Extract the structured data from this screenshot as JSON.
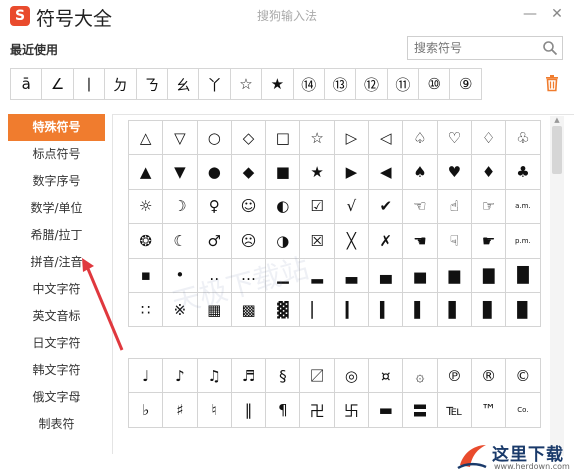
{
  "titlebar": {
    "logo_letter": "S",
    "app_title": "符号大全",
    "window_title": "搜狗输入法",
    "minimize": "—",
    "close": "✕"
  },
  "recent": {
    "label": "最近使用",
    "symbols": [
      "ā",
      "∠",
      "丨",
      "ㄉ",
      "ㄋ",
      "ㄠ",
      "丫",
      "☆",
      "★",
      "⑭",
      "⑬",
      "⑫",
      "⑪",
      "⑩",
      "⑨"
    ],
    "delete_icon": "trash-icon"
  },
  "search": {
    "placeholder": "搜索符号",
    "icon": "search-icon"
  },
  "sidebar": {
    "items": [
      {
        "label": "特殊符号",
        "active": true
      },
      {
        "label": "标点符号",
        "active": false
      },
      {
        "label": "数字序号",
        "active": false
      },
      {
        "label": "数学/单位",
        "active": false
      },
      {
        "label": "希腊/拉丁",
        "active": false
      },
      {
        "label": "拼音/注音",
        "active": false
      },
      {
        "label": "中文字符",
        "active": false
      },
      {
        "label": "英文音标",
        "active": false
      },
      {
        "label": "日文字符",
        "active": false
      },
      {
        "label": "韩文字符",
        "active": false
      },
      {
        "label": "俄文字母",
        "active": false
      },
      {
        "label": "制表符",
        "active": false
      }
    ]
  },
  "grid1": [
    [
      "△",
      "▽",
      "○",
      "◇",
      "□",
      "☆",
      "▷",
      "◁",
      "♤",
      "♡",
      "♢",
      "♧"
    ],
    [
      "▲",
      "▼",
      "●",
      "◆",
      "■",
      "★",
      "▶",
      "◀",
      "♠",
      "♥",
      "♦",
      "♣"
    ],
    [
      "☼",
      "☽",
      "♀",
      "☺",
      "◐",
      "☑",
      "√",
      "✔",
      "☜",
      "☝",
      "☞",
      "a.m."
    ],
    [
      "❂",
      "☾",
      "♂",
      "☹",
      "◑",
      "☒",
      "╳",
      "✗",
      "☚",
      "☟",
      "☛",
      "p.m."
    ],
    [
      "▪",
      "•",
      "‥",
      "…",
      "▁",
      "▂",
      "▃",
      "▄",
      "▅",
      "▆",
      "▇",
      "█"
    ],
    [
      "∷",
      "※",
      "▦",
      "▩",
      "▓",
      "▏",
      "▎",
      "▍",
      "▌",
      "▋",
      "▊",
      "▉"
    ]
  ],
  "grid2": [
    [
      "♩",
      "♪",
      "♫",
      "♬",
      "§",
      "〼",
      "◎",
      "¤",
      "۞",
      "℗",
      "®",
      "©"
    ],
    [
      "♭",
      "♯",
      "♮",
      "‖",
      "¶",
      "卍",
      "卐",
      "▬",
      "〓",
      "℡",
      "™",
      "Co."
    ]
  ],
  "watermark": "天极下载站",
  "brand": {
    "name": "这里下载",
    "url": "www.herdown.com",
    "accent": "#f07c2e",
    "logo_color": "#e94b2d"
  }
}
